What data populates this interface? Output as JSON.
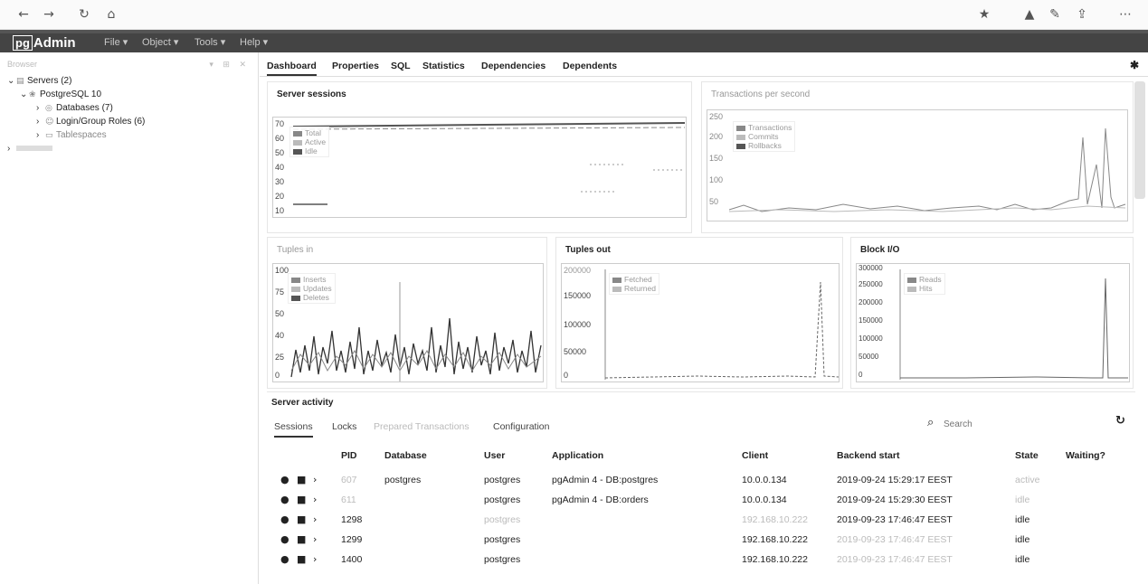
{
  "browser": {
    "back_icon": "arrow-left-icon",
    "forward_icon": "arrow-right-icon",
    "reload_icon": "reload-icon",
    "home_icon": "home-icon",
    "toolbar_icons": [
      "star-icon",
      "bookmark-icon",
      "pen-icon",
      "share-icon",
      "more-icon"
    ]
  },
  "app": {
    "logo_pg": "pg",
    "logo_text": "Admin",
    "menus": [
      "File ▾",
      "Object ▾",
      "Tools ▾",
      "Help ▾"
    ]
  },
  "tree": {
    "title": "Browser",
    "nodes": [
      {
        "label": "Servers (2)",
        "icon": "servers-icon"
      },
      {
        "label": "PostgreSQL 10",
        "icon": "elephant-icon"
      },
      {
        "label": "Databases (7)",
        "icon": "database-icon"
      },
      {
        "label": "Login/Group Roles (6)",
        "icon": "users-icon"
      },
      {
        "label": "Tablespaces",
        "icon": "folder-icon"
      }
    ]
  },
  "tabs": [
    "Dashboard",
    "Properties",
    "SQL",
    "Statistics",
    "Dependencies",
    "Dependents"
  ],
  "graphs": {
    "server_sessions": {
      "title": "Server sessions",
      "legend": [
        "Total",
        "Active",
        "Idle"
      ],
      "yticks": [
        "70",
        "60",
        "50",
        "40",
        "30",
        "20",
        "10"
      ]
    },
    "tps": {
      "title": "Transactions per second",
      "legend": [
        "Transactions",
        "Commits",
        "Rollbacks"
      ],
      "yticks": [
        "250",
        "200",
        "150",
        "100",
        "50"
      ]
    },
    "tuples_in": {
      "title": "Tuples in",
      "legend": [
        "Inserts",
        "Updates",
        "Deletes"
      ],
      "yticks": [
        "100",
        "75",
        "50",
        "40",
        "25",
        "0"
      ]
    },
    "tuples_out": {
      "title": "Tuples out",
      "legend": [
        "Fetched",
        "Returned"
      ],
      "yticks": [
        "200000",
        "150000",
        "100000",
        "50000",
        "0"
      ]
    },
    "block_io": {
      "title": "Block I/O",
      "legend": [
        "Reads",
        "Hits"
      ],
      "yticks": [
        "300000",
        "250000",
        "200000",
        "150000",
        "100000",
        "50000",
        "0"
      ]
    }
  },
  "activity": {
    "title": "Server activity",
    "subtabs": [
      "Sessions",
      "Locks",
      "Prepared Transactions",
      "Configuration"
    ],
    "search_placeholder": "Search",
    "columns": [
      "PID",
      "Database",
      "User",
      "Application",
      "Client",
      "Backend start",
      "State",
      "Waiting?"
    ],
    "rows": [
      {
        "pid": "607",
        "database": "postgres",
        "user": "postgres",
        "application": "pgAdmin 4 - DB:postgres",
        "client": "10.0.0.134",
        "backend_start": "2019-09-24 15:29:17 EEST",
        "state": "active",
        "waiting": ""
      },
      {
        "pid": "611",
        "database": "",
        "user": "postgres",
        "application": "pgAdmin 4 - DB:orders",
        "client": "10.0.0.134",
        "backend_start": "2019-09-24 15:29:30 EEST",
        "state": "idle",
        "waiting": ""
      },
      {
        "pid": "1298",
        "database": "",
        "user": "postgres",
        "application": "",
        "client": "192.168.10.222",
        "backend_start": "2019-09-23 17:46:47 EEST",
        "state": "idle",
        "waiting": ""
      },
      {
        "pid": "1299",
        "database": "",
        "user": "postgres",
        "application": "",
        "client": "192.168.10.222",
        "backend_start": "2019-09-23 17:46:47 EEST",
        "state": "idle",
        "waiting": ""
      },
      {
        "pid": "1400",
        "database": "",
        "user": "postgres",
        "application": "",
        "client": "192.168.10.222",
        "backend_start": "2019-09-23 17:46:47 EEST",
        "state": "idle",
        "waiting": ""
      }
    ]
  },
  "colors": {
    "menubar": "#444444",
    "series1": "#888888",
    "series2": "#bbbbbb",
    "series3": "#555555"
  }
}
